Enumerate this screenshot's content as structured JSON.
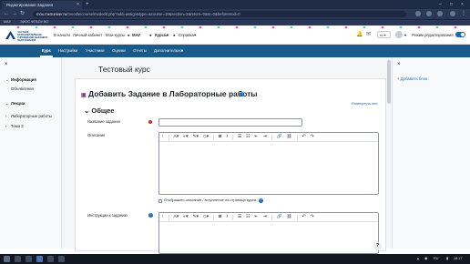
{
  "browser": {
    "tab_title": "Редактирование Задания",
    "url_host": "mou.mesuniver.ru",
    "url_rest": "/moodle/course/modedit.php?add=assign&type=&course=19&section=2&return=0&sr=0&beforemod=0",
    "bookmarks": [
      "МАУ",
      "ЭИОС ФГБОУ ВО"
    ]
  },
  "header": {
    "logo_text": "ЧАСТНОЕ ОБРАЗОВАТЕЛЬНОЕ УЧРЕЖДЕНИЕ ВЫСШЕГО ОБРАЗОВАНИЯ",
    "nav": [
      "В начало",
      "Личный кабинет",
      "Мои курсы",
      "МАУ",
      "Курсы",
      "Справка"
    ],
    "lang": "ru",
    "edit_mode_label": "Режим редактирования"
  },
  "course_nav": [
    "Курс",
    "Настройки",
    "Участники",
    "Оценки",
    "Отчеты",
    "Дополнительно"
  ],
  "left_drawer": {
    "sections": [
      {
        "label": "Информация",
        "children": [
          "Объявления"
        ]
      },
      {
        "label": "Лекции",
        "children": []
      },
      {
        "label": "Лабораторные работы",
        "children": []
      },
      {
        "label": "Тема 3",
        "children": []
      }
    ]
  },
  "right_drawer": {
    "add_block": "Добавить блок"
  },
  "main": {
    "course_title": "Тестовый курс",
    "page_title": "Добавить Задание в Лабораторные работы",
    "expand_all": "Развернуть все",
    "section": "Общее",
    "fields": {
      "name_label": "Название задания",
      "desc_label": "Описание",
      "show_desc_label": "Отображать описание / вступление на странице курса",
      "instructions_label": "Инструкции к заданию"
    }
  },
  "taskbar": {
    "lang": "RU",
    "time": "18:17"
  }
}
